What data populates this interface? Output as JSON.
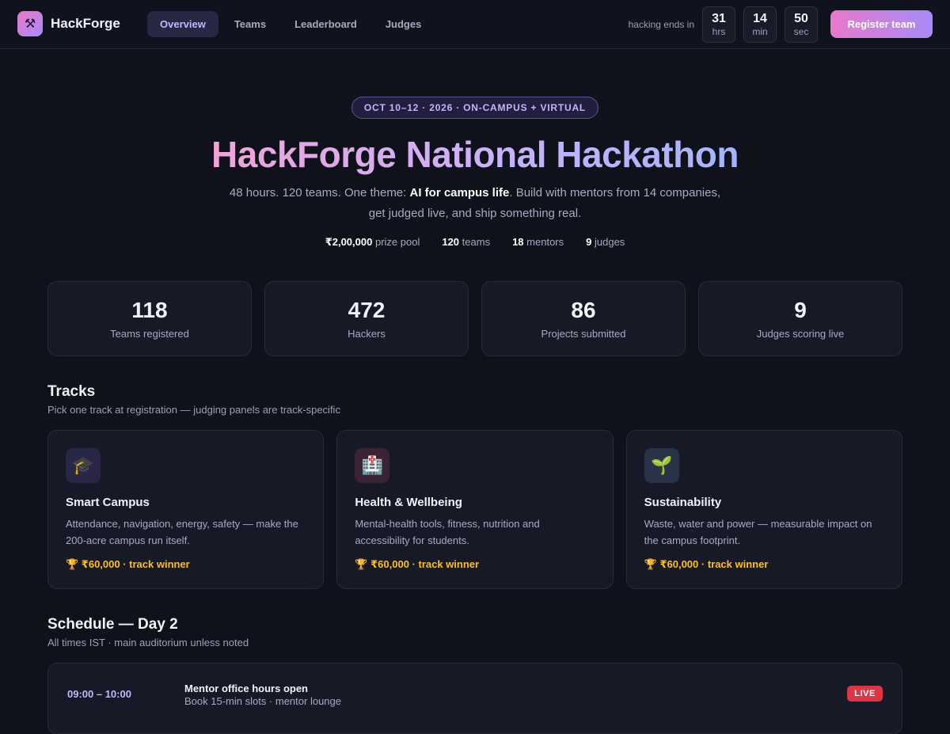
{
  "nav": {
    "brand": "HackForge",
    "logo_icon": "⚒",
    "tabs": [
      "Overview",
      "Teams",
      "Leaderboard",
      "Judges"
    ],
    "active_tab": "Overview",
    "countdown": {
      "label": "hacking ends in",
      "units": [
        {
          "value": "31",
          "unit": "hrs"
        },
        {
          "value": "14",
          "unit": "min"
        },
        {
          "value": "50",
          "unit": "sec"
        }
      ]
    },
    "register_label": "Register team"
  },
  "hero": {
    "pill": "OCT 10–12 · 2026 · ON-CAMPUS + VIRTUAL",
    "title": "HackForge National Hackathon",
    "sub_before": "48 hours. 120 teams. One theme: ",
    "sub_strong": "AI for campus life",
    "sub_after": ". Build with mentors from 14 companies, get judged live, and ship something real.",
    "facts": [
      {
        "value": "₹2,00,000",
        "label": "prize pool"
      },
      {
        "value": "120",
        "label": "teams"
      },
      {
        "value": "18",
        "label": "mentors"
      },
      {
        "value": "9",
        "label": "judges"
      }
    ]
  },
  "stats": [
    {
      "value": "118",
      "label": "Teams registered"
    },
    {
      "value": "472",
      "label": "Hackers"
    },
    {
      "value": "86",
      "label": "Projects submitted"
    },
    {
      "value": "9",
      "label": "Judges scoring live"
    }
  ],
  "tracks": {
    "title": "Tracks",
    "subtitle": "Pick one track at registration — judging panels are track-specific",
    "items": [
      {
        "icon": "🎓",
        "icon_bg": "#2a2647",
        "name": "Smart Campus",
        "desc": "Attendance, navigation, energy, safety — make the 200-acre campus run itself.",
        "prize": "🏆 ₹60,000 · track winner"
      },
      {
        "icon": "🏥",
        "icon_bg": "#3a2434",
        "name": "Health & Wellbeing",
        "desc": "Mental-health tools, fitness, nutrition and accessibility for students.",
        "prize": "🏆 ₹60,000 · track winner"
      },
      {
        "icon": "🌱",
        "icon_bg": "#283248",
        "name": "Sustainability",
        "desc": "Waste, water and power — measurable impact on the campus footprint.",
        "prize": "🏆 ₹60,000 · track winner"
      }
    ]
  },
  "schedule": {
    "title": "Schedule — Day 2",
    "subtitle": "All times IST · main auditorium unless noted",
    "items": [
      {
        "time": "09:00 – 10:00",
        "title": "Mentor office hours open",
        "meta": "Book 15-min slots · mentor lounge",
        "badge": "LIVE"
      }
    ]
  },
  "colors": {
    "accent_pink": "#e879c9",
    "accent_violet": "#a78bfa",
    "prize_gold": "#fbbf24",
    "live_red": "#dc3545"
  }
}
